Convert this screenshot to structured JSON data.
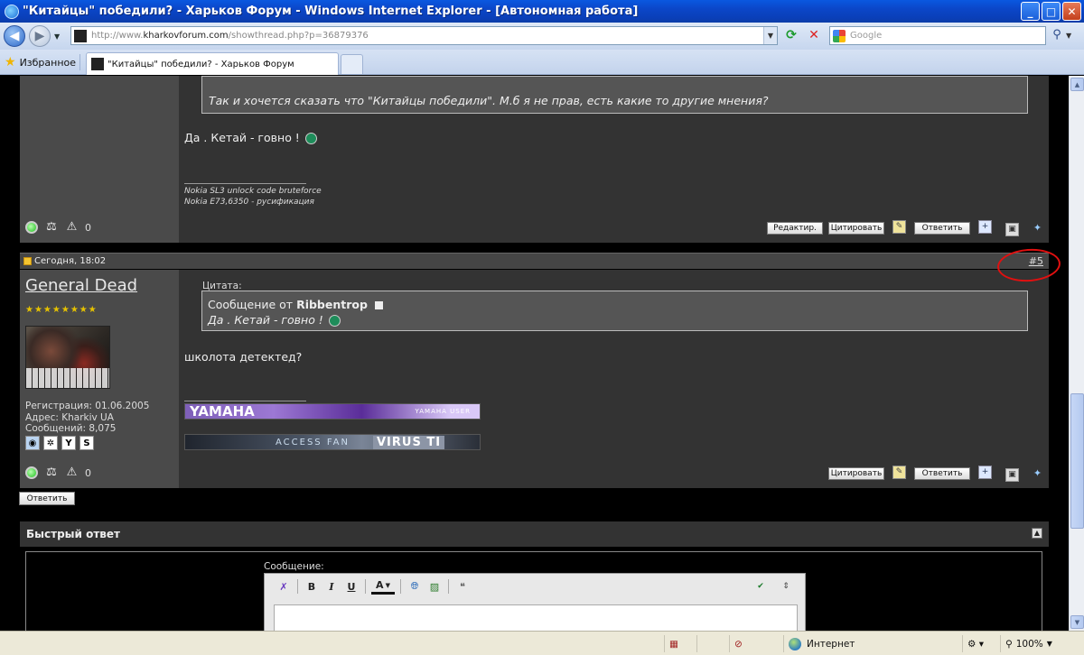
{
  "window": {
    "title": "\"Китайцы\" победили? - Харьков Форум - Windows Internet Explorer - [Автономная работа]",
    "minimize": "_",
    "maximize": "□",
    "close": "✕"
  },
  "addressbar": {
    "url_prefix": "http://www.",
    "url_domain": "kharkovforum.com",
    "url_path": "/showthread.php?p=36879376",
    "search_placeholder": "Google"
  },
  "tabs": {
    "favorites_label": "Избранное",
    "active_tab_label": "\"Китайцы\" победили? - Харьков Форум"
  },
  "post4": {
    "quote_text": "Так и хочется сказать что \"Китайцы победили\". М.б я не прав, есть какие то другие мнения?",
    "message": "Да . Кетай - говно !",
    "signature": [
      "Nokia SL3 unlock code bruteforce",
      "Nokia E73,6350 - русификация"
    ],
    "status_zero": "0",
    "buttons": {
      "edit": "Редактир.",
      "quote": "Цитировать",
      "reply": "Ответить"
    }
  },
  "post5": {
    "date": "Сегодня, 18:02",
    "post_number": "#5",
    "username": "General Dead",
    "stars": "★★★★★★★★",
    "registration": "Регистрация: 01.06.2005",
    "address": "Адрес: Kharkiv UA",
    "messages": "Сообщений: 8,075",
    "quote_label": "Цитата:",
    "quote_from_prefix": "Сообщение от ",
    "quote_author": "Ribbentrop",
    "quote_text": "Да . Кетай - говно !",
    "message": "школота детектед?",
    "banner_yamaha": "YAMAHA",
    "banner_yamaha_tag": "YAMAHA USER",
    "banner_access": "ACCESS FAN",
    "banner_virus": "VIRUS TI",
    "status_zero": "0",
    "buttons": {
      "quote": "Цитировать",
      "reply": "Ответить"
    }
  },
  "thread": {
    "reply_button": "Ответить"
  },
  "quick_reply": {
    "title": "Быстрый ответ",
    "message_label": "Сообщение:",
    "toolbar": {
      "bold": "B",
      "italic": "I",
      "underline": "U",
      "font_color": "A"
    }
  },
  "statusbar": {
    "zone": "Интернет",
    "zoom": "100%"
  }
}
